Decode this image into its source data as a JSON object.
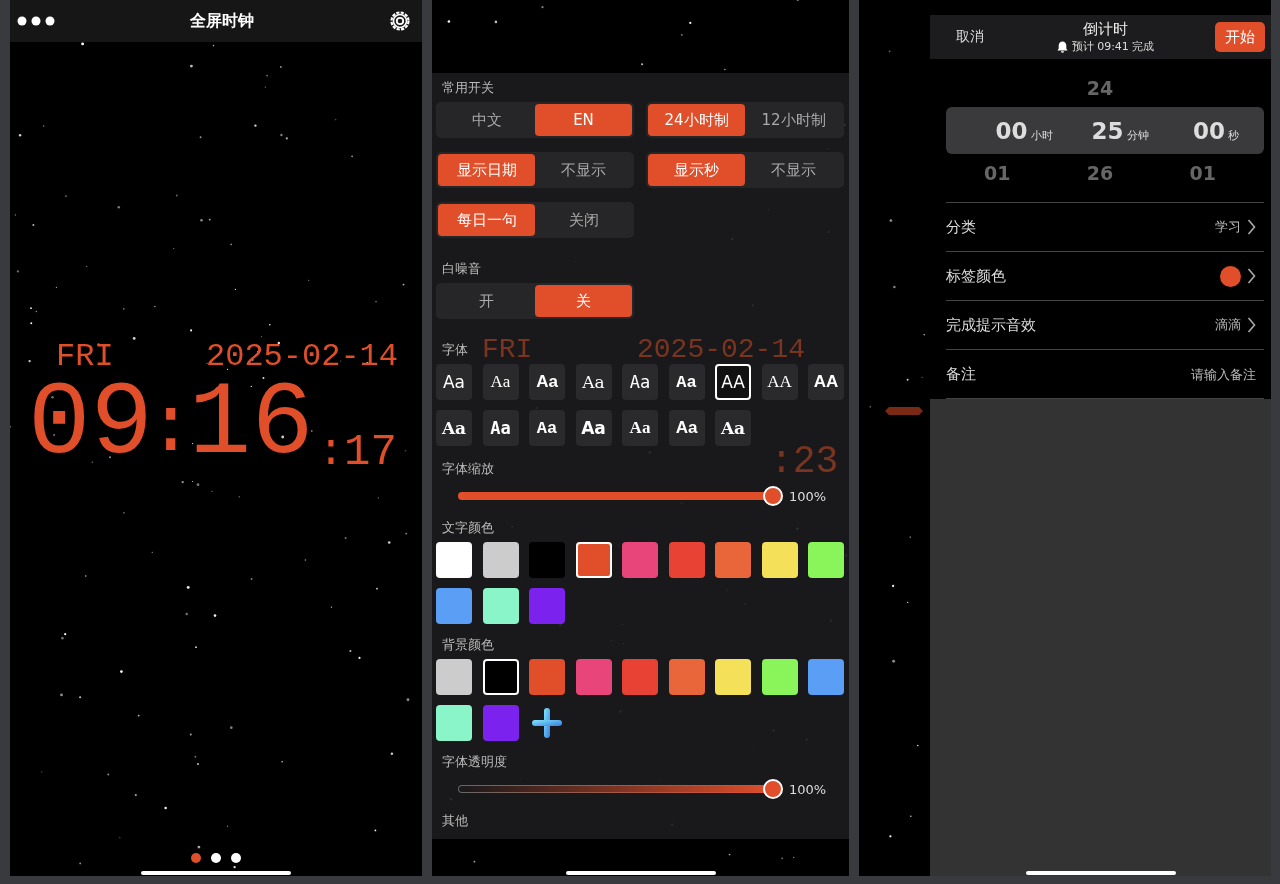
{
  "clock_screen": {
    "title": "全屏时钟",
    "day": "FRI",
    "date": "2025-02-14",
    "hours": "09",
    "separator": ":",
    "minutes": "16",
    "seconds_separator": ":",
    "seconds": "17",
    "page_dots": [
      {
        "selected": true
      },
      {
        "selected": false
      },
      {
        "selected": false
      }
    ]
  },
  "settings_screen": {
    "ghost_clock": {
      "day": "FRI",
      "date": "2025-02-14",
      "seconds": ":23"
    },
    "sections": [
      {
        "kind": "toggles",
        "title": "常用开关",
        "groups": [
          {
            "options": [
              {
                "label": "中文",
                "selected": false
              },
              {
                "label": "EN",
                "selected": true
              }
            ]
          },
          {
            "options": [
              {
                "label": "24小时制",
                "selected": true
              },
              {
                "label": "12小时制",
                "selected": false
              }
            ]
          },
          {
            "options": [
              {
                "label": "显示日期",
                "selected": true
              },
              {
                "label": "不显示",
                "selected": false
              }
            ]
          },
          {
            "options": [
              {
                "label": "显示秒",
                "selected": true
              },
              {
                "label": "不显示",
                "selected": false
              }
            ]
          },
          {
            "options": [
              {
                "label": "每日一句",
                "selected": true
              },
              {
                "label": "关闭",
                "selected": false
              }
            ]
          }
        ]
      },
      {
        "kind": "toggles",
        "title": "白噪音",
        "groups": [
          {
            "options": [
              {
                "label": "开",
                "selected": false
              },
              {
                "label": "关",
                "selected": true
              }
            ]
          }
        ]
      },
      {
        "kind": "fonts",
        "title": "字体",
        "items": [
          {
            "label": "Aa",
            "selected": false
          },
          {
            "label": "Aa",
            "selected": false
          },
          {
            "label": "Aa",
            "selected": false
          },
          {
            "label": "Aa",
            "selected": false
          },
          {
            "label": "Aa",
            "selected": false
          },
          {
            "label": "Aa",
            "selected": false
          },
          {
            "label": "AA",
            "selected": true
          },
          {
            "label": "AA",
            "selected": false
          },
          {
            "label": "AA",
            "selected": false
          },
          {
            "label": "Aa",
            "selected": false
          },
          {
            "label": "Aa",
            "selected": false
          },
          {
            "label": "Aa",
            "selected": false
          },
          {
            "label": "Aa",
            "selected": false
          },
          {
            "label": "Aa",
            "selected": false
          },
          {
            "label": "Aa",
            "selected": false
          },
          {
            "label": "Aa",
            "selected": false
          }
        ]
      },
      {
        "kind": "slider",
        "title": "字体缩放",
        "level": 1,
        "reading": "100%"
      },
      {
        "kind": "swatches",
        "title": "文字颜色",
        "items": [
          {
            "color": "#ffffff",
            "selected": false
          },
          {
            "color": "#cccccc",
            "selected": false
          },
          {
            "color": "#000000",
            "selected": false
          },
          {
            "color": "#e04e2a",
            "selected": true
          },
          {
            "color": "#e8457a",
            "selected": false
          },
          {
            "color": "#e84234",
            "selected": false
          },
          {
            "color": "#e8663a",
            "selected": false
          },
          {
            "color": "#f5e05a",
            "selected": false
          },
          {
            "color": "#8af55a",
            "selected": false
          },
          {
            "color": "#5a9ef5",
            "selected": false
          },
          {
            "color": "#8af5c8",
            "selected": false
          },
          {
            "color": "#7b22ee",
            "selected": false
          }
        ]
      },
      {
        "kind": "swatches",
        "title": "背景颜色",
        "add_button": true,
        "items": [
          {
            "color": "#cccccc",
            "selected": false
          },
          {
            "color": "#000000",
            "selected": true
          },
          {
            "color": "#e04e2a",
            "selected": false
          },
          {
            "color": "#e8457a",
            "selected": false
          },
          {
            "color": "#e84234",
            "selected": false
          },
          {
            "color": "#e8663a",
            "selected": false
          },
          {
            "color": "#f5e05a",
            "selected": false
          },
          {
            "color": "#8af55a",
            "selected": false
          },
          {
            "color": "#5a9ef5",
            "selected": false
          },
          {
            "color": "#8af5c8",
            "selected": false
          },
          {
            "color": "#7b22ee",
            "selected": false
          }
        ]
      },
      {
        "kind": "fade-slider",
        "title": "字体透明度",
        "level": 1,
        "reading": "100%"
      },
      {
        "kind": "heading",
        "title": "其他"
      }
    ]
  },
  "countdown_sheet": {
    "cancel": "取消",
    "title": "倒计时",
    "subtitle": "预计 09:41 完成",
    "start": "开始",
    "picker": [
      {
        "value": "00",
        "unit": "小时",
        "below": "01"
      },
      {
        "above": "24",
        "value": "25",
        "unit": "分钟",
        "below": "26"
      },
      {
        "value": "00",
        "unit": "秒",
        "below": "01"
      }
    ],
    "rows": [
      {
        "kind": "value",
        "label": "分类",
        "value": "学习"
      },
      {
        "kind": "color",
        "label": "标签颜色",
        "color": "#e04e2a"
      },
      {
        "kind": "value",
        "label": "完成提示音效",
        "value": "滴滴"
      },
      {
        "kind": "input",
        "label": "备注",
        "placeholder": "请输入备注"
      }
    ]
  }
}
